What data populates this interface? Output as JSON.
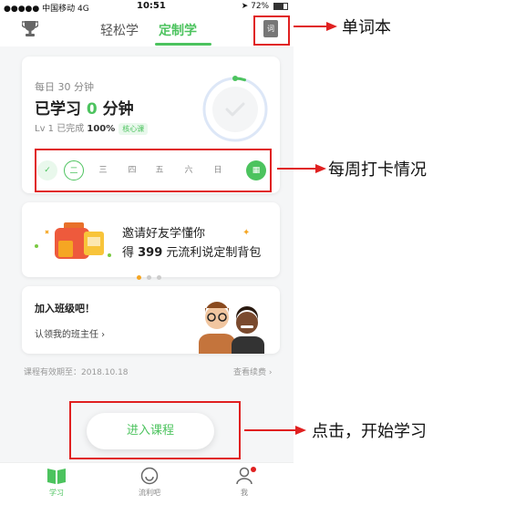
{
  "status_bar": {
    "carrier": "●●●●● 中国移动  4G",
    "time": "10:51",
    "battery": "72%",
    "battery_level": 0.72
  },
  "header": {
    "tabs": [
      "轻松学",
      "定制学"
    ],
    "active_tab": 1,
    "vocab_icon_text": "词"
  },
  "daily": {
    "label": "每日 30 分钟",
    "studied_prefix": "已学习 ",
    "studied_minutes": "0",
    "studied_suffix": " 分钟",
    "level_prefix": "Lv 1 已完成 ",
    "level_percent": "100%",
    "badge": "核心课",
    "progress": 0.05
  },
  "week": {
    "days": [
      "✓",
      "二",
      "三",
      "四",
      "五",
      "六",
      "日"
    ],
    "done_index": 0,
    "today_index": 1
  },
  "promo": {
    "line1": "邀请好友学懂你",
    "line2_prefix": "得 ",
    "amount": "399",
    "line2_suffix": " 元流利说定制背包"
  },
  "class_card": {
    "title": "加入班级吧！",
    "link": "认领我的班主任 ›"
  },
  "footer_info": {
    "validity": "课程有效期至：2018.10.18",
    "renew": "查看续费 ›"
  },
  "enter_button": "进入课程",
  "bottom_nav": [
    {
      "label": "学习",
      "icon": "book-icon"
    },
    {
      "label": "流利吧",
      "icon": "smile-icon"
    },
    {
      "label": "我",
      "icon": "person-icon"
    }
  ],
  "annotations": {
    "vocab": "单词本",
    "week": "每周打卡情况",
    "start": "点击，开始学习"
  },
  "colors": {
    "accent": "#4cc35e",
    "annotation_red": "#e02020"
  }
}
